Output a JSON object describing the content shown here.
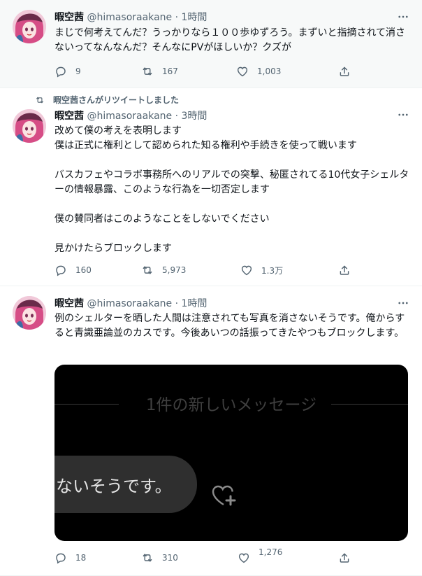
{
  "tweets": [
    {
      "author": {
        "name": "暇空茜",
        "handle": "@himasoraakane",
        "time": "1時間"
      },
      "text": "まじで何考えてんだ？うっかりなら１００歩ゆずろう。まずいと指摘されて消さないってなんなんだ？そんなにPVがほしいか？クズが",
      "stats": {
        "replies": "9",
        "retweets": "167",
        "likes": "1,003"
      }
    },
    {
      "retweet_banner": "暇空茜さんがリツイートしました",
      "author": {
        "name": "暇空茜",
        "handle": "@himasoraakane",
        "time": "3時間"
      },
      "text": "改めて僕の考えを表明します\n僕は正式に権利として認められた知る権利や手続きを使って戦います\n\nバスカフェやコラボ事務所へのリアルでの突撃、秘匿されてる10代女子シェルターの情報暴露、このような行為を一切否定します\n\n僕の賛同者はこのようなことをしないでください\n\n見かけたらブロックします",
      "stats": {
        "replies": "160",
        "retweets": "5,973",
        "likes": "1.3万"
      }
    },
    {
      "author": {
        "name": "暇空茜",
        "handle": "@himasoraakane",
        "time": "1時間"
      },
      "text": "例のシェルターを晒した人間は注意されても写真を消さないそうです。俺からすると青識亜論並のカスです。今後あいつの話振ってきたやつもブロックします。",
      "media": {
        "header": "1件の新しいメッセージ",
        "bubble_text": "ないそうです。"
      },
      "stats": {
        "replies": "18",
        "retweets": "310",
        "likes": "1,276"
      }
    }
  ],
  "icons": [
    "more-icon",
    "reply-icon",
    "retweet-icon",
    "like-icon",
    "share-icon",
    "heart-plus-icon"
  ],
  "colors": {
    "muted": "#536471",
    "highlight_bg": "#f7f9f9",
    "media_bg": "#000000"
  }
}
